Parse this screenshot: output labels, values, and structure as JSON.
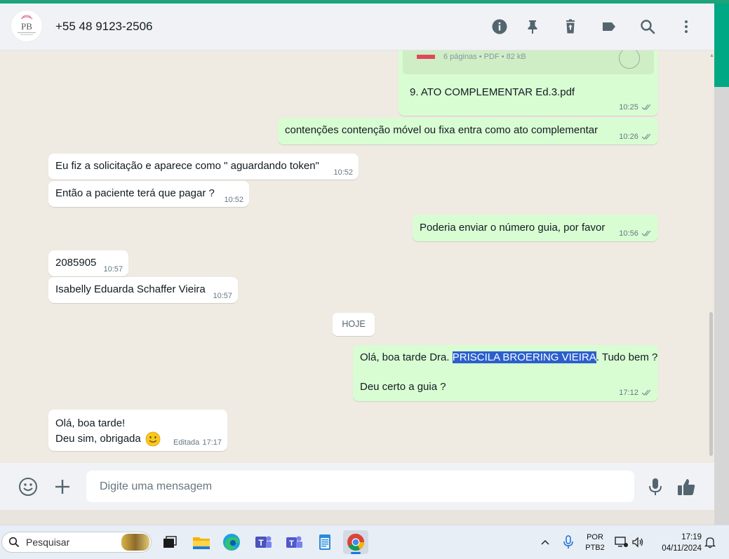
{
  "header": {
    "contact_name": "+55 48 9123-2506",
    "avatar_initials": "PB",
    "icons": [
      "info-icon",
      "pin-icon",
      "delete-icon",
      "label-icon",
      "search-icon",
      "menu-icon"
    ]
  },
  "messages": {
    "doc_meta": "6 páginas • PDF • 82 kB",
    "doc_name": "9. ATO COMPLEMENTAR Ed.3.pdf",
    "doc_time": "10:25",
    "m1_text": "contenções contenção móvel ou fixa entra como ato complementar",
    "m1_time": "10:26",
    "m2_text": "Eu fiz a solicitação e aparece como \" aguardando token\"",
    "m2_time": "10:52",
    "m3_text": "Então a paciente terá que pagar ?",
    "m3_time": "10:52",
    "m4_text": "Poderia enviar o número guia, por favor",
    "m4_time": "10:56",
    "m5_text": "2085905",
    "m5_time": "10:57",
    "m6_text": "Isabelly Eduarda Schaffer Vieira",
    "m6_time": "10:57",
    "date_divider": "HOJE",
    "m7_prefix": "Olá, boa tarde Dra. ",
    "m7_highlight": "PRISCILA BROERING VIEIRA",
    "m7_suffix": ". Tudo bem ?",
    "m7_line2": "Deu certo a guia ?",
    "m7_time": "17:12",
    "m8_line1": "Olá, boa tarde!",
    "m8_line2": "Deu sim, obrigada",
    "m8_edited": "Editada",
    "m8_time": "17:17"
  },
  "composer": {
    "placeholder": "Digite uma mensagem"
  },
  "taskbar": {
    "search_label": "Pesquisar",
    "lang_line1": "POR",
    "lang_line2": "PTB2",
    "clock_time": "17:19",
    "clock_date": "04/11/2024"
  },
  "colors": {
    "accent": "#00a884",
    "outgoing": "#d9fdd3",
    "incoming": "#ffffff",
    "selection": "#2b5fce"
  }
}
